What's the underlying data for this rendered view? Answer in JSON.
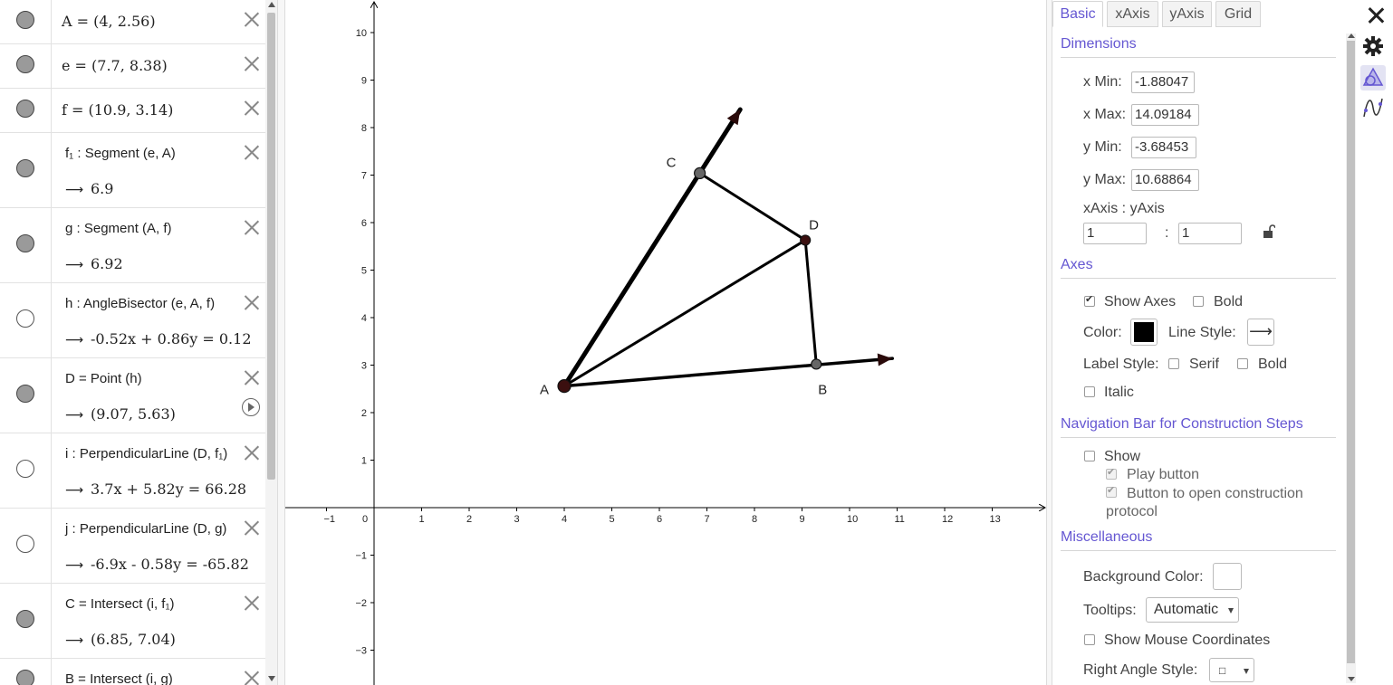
{
  "algebra": {
    "rows": [
      {
        "def": "A = (4, 2.56)",
        "value": "",
        "visible": true
      },
      {
        "def": "e = (7.7, 8.38)",
        "value": "",
        "visible": true
      },
      {
        "def": "f = (10.9, 3.14)",
        "value": "",
        "visible": true
      },
      {
        "def": "f₁ : Segment (e, A)",
        "value": "6.9",
        "visible": true
      },
      {
        "def": "g : Segment (A, f)",
        "value": "6.92",
        "visible": true
      },
      {
        "def": "h : AngleBisector (e, A, f)",
        "value": "-0.52x + 0.86y = 0.12",
        "visible": false
      },
      {
        "def": "D = Point (h)",
        "value": "(9.07, 5.63)",
        "visible": true
      },
      {
        "def": "i : PerpendicularLine (D, f₁)",
        "value": "3.7x + 5.82y = 66.28",
        "visible": false
      },
      {
        "def": "j : PerpendicularLine (D, g)",
        "value": "-6.9x - 0.58y = -65.82",
        "visible": false
      },
      {
        "def": "C = Intersect (i, f₁)",
        "value": "(6.85, 7.04)",
        "visible": true
      },
      {
        "def": "B = Intersect (i, g)",
        "value": "",
        "visible": true
      }
    ],
    "value_arrow": "⟶",
    "icons": {
      "delete": "close-icon",
      "animate": "play-icon"
    }
  },
  "graphics": {
    "x_ticks": [
      "−1",
      "0",
      "1",
      "2",
      "3",
      "4",
      "5",
      "6",
      "7",
      "8",
      "9",
      "10",
      "11",
      "12",
      "13"
    ],
    "y_ticks": [
      "10",
      "9",
      "8",
      "7",
      "6",
      "5",
      "4",
      "3",
      "2",
      "1",
      "−1",
      "−2",
      "−3"
    ],
    "points": {
      "A": {
        "label": "A",
        "x": 4,
        "y": 2.56
      },
      "B": {
        "label": "B",
        "x": 9.3,
        "y": 3.02
      },
      "C": {
        "label": "C",
        "x": 6.85,
        "y": 7.04
      },
      "D": {
        "label": "D",
        "x": 9.07,
        "y": 5.63
      },
      "e": {
        "x": 7.7,
        "y": 8.38
      },
      "f": {
        "x": 10.9,
        "y": 3.14
      }
    },
    "axes_color": "#000000"
  },
  "properties": {
    "tabs": [
      "Basic",
      "xAxis",
      "yAxis",
      "Grid"
    ],
    "active_tab": "Basic",
    "sections": {
      "dimensions": "Dimensions",
      "axes": "Axes",
      "navigation": "Navigation Bar for Construction Steps",
      "misc": "Miscellaneous"
    },
    "dims": {
      "xmin_label": "x Min:",
      "xmin": "-1.88047",
      "xmax_label": "x Max:",
      "xmax": "14.09184",
      "ymin_label": "y Min:",
      "ymin": "-3.68453",
      "ymax_label": "y Max:",
      "ymax": "10.68864",
      "ratio_label": "xAxis : yAxis",
      "ratio_x": "1",
      "ratio_sep": ":",
      "ratio_y": "1"
    },
    "axes": {
      "show_axes": "Show Axes",
      "show_axes_checked": true,
      "bold": "Bold",
      "bold_checked": false,
      "color_label": "Color:",
      "color": "#000000",
      "line_style_label": "Line Style:",
      "line_style_glyph": "⟶",
      "label_style": "Label Style:",
      "serif": "Serif",
      "bold2": "Bold",
      "italic": "Italic"
    },
    "nav": {
      "show": "Show",
      "play": "Play button",
      "protocol": "Button to open construction protocol"
    },
    "misc": {
      "bg_label": "Background Color:",
      "tooltips_label": "Tooltips:",
      "tooltips_value": "Automatic",
      "mouse_coords": "Show Mouse Coordinates",
      "right_angle_label": "Right Angle Style:",
      "right_angle_value": "□"
    },
    "side_icons": [
      "gear-icon",
      "graphics-view-icon",
      "function-curve-icon"
    ]
  }
}
